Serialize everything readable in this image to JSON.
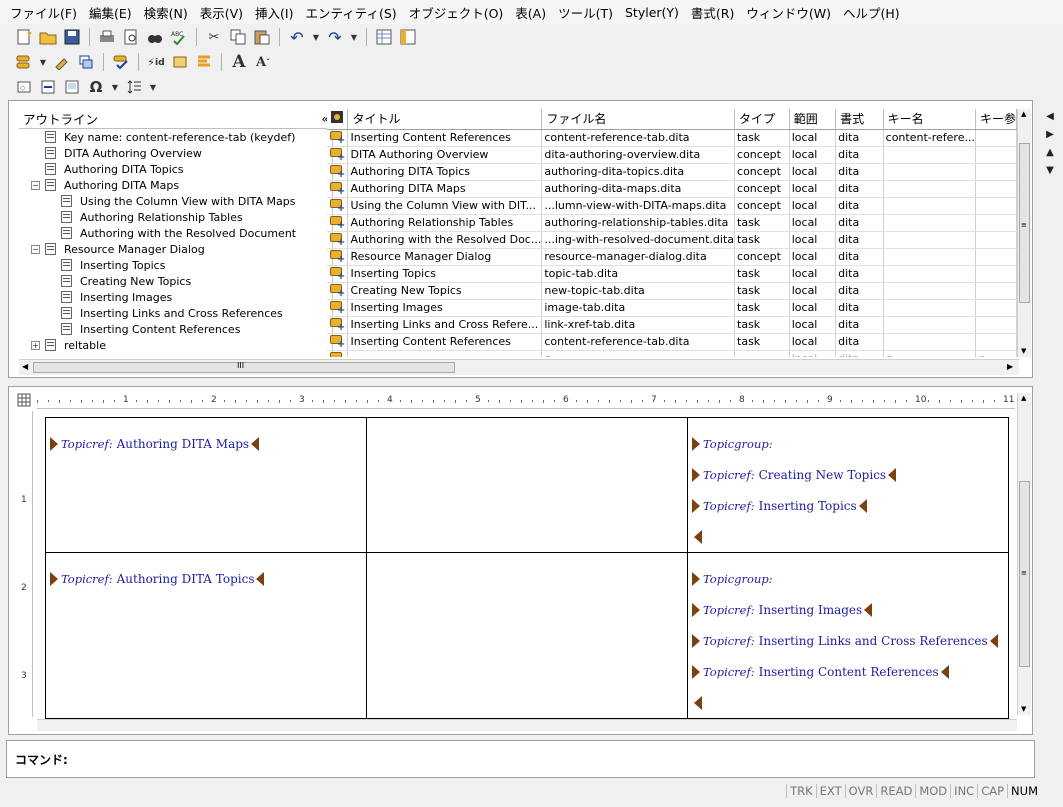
{
  "menu": [
    "ファイル(F)",
    "編集(E)",
    "検索(N)",
    "表示(V)",
    "挿入(I)",
    "エンティティ(S)",
    "オブジェクト(O)",
    "表(A)",
    "ツール(T)",
    "Styler(Y)",
    "書式(R)",
    "ウィンドウ(W)",
    "ヘルプ(H)"
  ],
  "toolbar_icons": [
    "new-document-icon",
    "open-folder-icon",
    "save-icon",
    "print-icon",
    "print-preview-icon",
    "find-icon",
    "spell-check-icon",
    "cut-icon",
    "copy-icon",
    "paste-icon",
    "undo-icon",
    "redo-icon",
    "table-icon",
    "split-view-icon"
  ],
  "outline": {
    "title": "アウトライン",
    "collapse": "«",
    "items": [
      {
        "label": "Key name: content-reference-tab (keydef)",
        "level": 1
      },
      {
        "label": "DITA Authoring Overview",
        "level": 1
      },
      {
        "label": "Authoring DITA Topics",
        "level": 1
      },
      {
        "label": "Authoring DITA Maps",
        "level": 1,
        "toggle": "−"
      },
      {
        "label": "Using the Column View with DITA Maps",
        "level": 2
      },
      {
        "label": "Authoring Relationship Tables",
        "level": 2
      },
      {
        "label": "Authoring with the Resolved Document",
        "level": 2
      },
      {
        "label": "Resource Manager Dialog",
        "level": 1,
        "toggle": "−"
      },
      {
        "label": "Inserting Topics",
        "level": 2
      },
      {
        "label": "Creating New Topics",
        "level": 2
      },
      {
        "label": "Inserting Images",
        "level": 2
      },
      {
        "label": "Inserting Links and Cross References",
        "level": 2
      },
      {
        "label": "Inserting Content References",
        "level": 2
      },
      {
        "label": "reltable",
        "level": 1,
        "toggle": "+"
      }
    ]
  },
  "grid": {
    "columns": [
      "タイトル",
      "ファイル名",
      "タイプ",
      "範囲",
      "書式",
      "キー名",
      "キー参"
    ],
    "rows": [
      [
        "Inserting Content References",
        "content-reference-tab.dita",
        "task",
        "local",
        "dita",
        "content-refere..."
      ],
      [
        "DITA Authoring Overview",
        "dita-authoring-overview.dita",
        "concept",
        "local",
        "dita",
        ""
      ],
      [
        "Authoring DITA Topics",
        "authoring-dita-topics.dita",
        "concept",
        "local",
        "dita",
        ""
      ],
      [
        "Authoring DITA Maps",
        "authoring-dita-maps.dita",
        "concept",
        "local",
        "dita",
        ""
      ],
      [
        "Using the Column View with DIT...",
        "...lumn-view-with-DITA-maps.dita",
        "concept",
        "local",
        "dita",
        ""
      ],
      [
        "Authoring Relationship Tables",
        "authoring-relationship-tables.dita",
        "task",
        "local",
        "dita",
        ""
      ],
      [
        "Authoring with the Resolved Doc...",
        "...ing-with-resolved-document.dita",
        "task",
        "local",
        "dita",
        ""
      ],
      [
        "Resource Manager Dialog",
        "resource-manager-dialog.dita",
        "concept",
        "local",
        "dita",
        ""
      ],
      [
        "Inserting Topics",
        "topic-tab.dita",
        "task",
        "local",
        "dita",
        ""
      ],
      [
        "Creating New Topics",
        "new-topic-tab.dita",
        "task",
        "local",
        "dita",
        ""
      ],
      [
        "Inserting Images",
        "image-tab.dita",
        "task",
        "local",
        "dita",
        ""
      ],
      [
        "Inserting Links and Cross Refere...",
        "link-xref-tab.dita",
        "task",
        "local",
        "dita",
        ""
      ],
      [
        "Inserting Content References",
        "content-reference-tab.dita",
        "task",
        "local",
        "dita",
        ""
      ]
    ],
    "empty_row": [
      "",
      "ø",
      "",
      "local",
      "dita",
      "ø",
      "ø"
    ]
  },
  "hscroll_grip": "III",
  "ruler": {
    "numbers": [
      "1",
      "2",
      "3",
      "4",
      "5",
      "6",
      "7",
      "8",
      "9",
      "10",
      "11"
    ],
    "vnumbers": [
      "1",
      "2",
      "3"
    ]
  },
  "reltable": {
    "topicref_tag": "Topicref:",
    "topicgroup_tag": "Topicgroup:",
    "row1": {
      "left": "Authoring DITA Maps",
      "right": [
        "Creating New Topics",
        "Inserting Topics"
      ]
    },
    "row2": {
      "left": "Authoring DITA Topics",
      "right": [
        "Inserting Images",
        "Inserting Links and Cross References",
        "Inserting Content References"
      ]
    }
  },
  "command_label": "コマンド:",
  "status": [
    "TRK",
    "EXT",
    "OVR",
    "READ",
    "MOD",
    "INC",
    "CAP",
    "NUM"
  ]
}
